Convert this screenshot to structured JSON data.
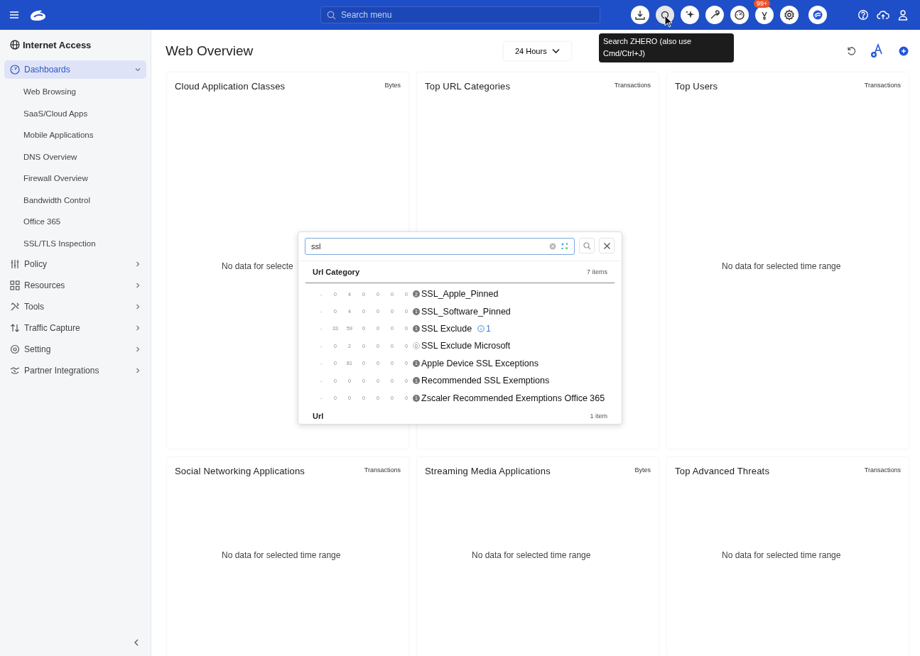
{
  "topbar": {
    "search": {
      "placeholder": "Search menu"
    },
    "notification_badge": "99+",
    "tooltip": "Search ZHERO (also use Cmd/Ctrl+J)"
  },
  "sidebar": {
    "title": "Internet Access",
    "items": [
      {
        "label": "Dashboards",
        "selected": true,
        "expanded": true,
        "children": [
          {
            "label": "Web Browsing"
          },
          {
            "label": "SaaS/Cloud Apps"
          },
          {
            "label": "Mobile Applications"
          },
          {
            "label": "DNS Overview"
          },
          {
            "label": "Firewall Overview"
          },
          {
            "label": "Bandwidth Control"
          },
          {
            "label": "Office 365"
          },
          {
            "label": "SSL/TLS Inspection"
          }
        ]
      },
      {
        "label": "Policy",
        "selected": false,
        "expanded": false
      },
      {
        "label": "Resources",
        "selected": false,
        "expanded": false
      },
      {
        "label": "Tools",
        "selected": false,
        "expanded": false
      },
      {
        "label": "Traffic Capture",
        "selected": false,
        "expanded": false
      },
      {
        "label": "Setting",
        "selected": false,
        "expanded": false
      },
      {
        "label": "Partner Integrations",
        "selected": false,
        "expanded": false
      }
    ]
  },
  "page": {
    "title": "Web Overview",
    "time_range": "24 Hours"
  },
  "cards": [
    {
      "title": "Cloud Application Classes",
      "unit": "Bytes",
      "message": "No data for selecte"
    },
    {
      "title": "Top URL Categories",
      "unit": "Transactions"
    },
    {
      "title": "Top Users",
      "unit": "Transactions",
      "message": "No data for selected time range"
    },
    {
      "title": "Social Networking Applications",
      "unit": "Transactions",
      "message": "No data for selected time range"
    },
    {
      "title": "Streaming Media Applications",
      "unit": "Bytes",
      "message": "No data for selected time range"
    },
    {
      "title": "Top Advanced Threats",
      "unit": "Transactions",
      "message": "No data for selected time range"
    }
  ],
  "search_popup": {
    "value": "ssl",
    "sections": [
      {
        "title": "Url Category",
        "count": "7 items",
        "rows": [
          {
            "cells": [
              "-",
              "0",
              "4",
              "0",
              "0",
              "0",
              "0"
            ],
            "badge": "2",
            "dim": false,
            "name": "SSL_Apple_Pinned"
          },
          {
            "cells": [
              "-",
              "0",
              "4",
              "0",
              "0",
              "0",
              "0"
            ],
            "badge": "1",
            "dim": false,
            "name": "SSL_Software_Pinned"
          },
          {
            "cells": [
              "-",
              "33",
              "59",
              "0",
              "0",
              "0",
              "0"
            ],
            "badge": "1",
            "dim": false,
            "name": "SSL Exclude",
            "extra": "1"
          },
          {
            "cells": [
              "-",
              "0",
              "2",
              "0",
              "0",
              "0",
              "0"
            ],
            "badge": "0",
            "dim": true,
            "name": "SSL Exclude Microsoft"
          },
          {
            "cells": [
              "-",
              "0",
              "81",
              "0",
              "0",
              "0",
              "0"
            ],
            "badge": "1",
            "dim": false,
            "name": "Apple Device SSL Exceptions"
          },
          {
            "cells": [
              "-",
              "0",
              "0",
              "0",
              "0",
              "0",
              "0"
            ],
            "badge": "1",
            "dim": false,
            "name": "Recommended SSL Exemptions"
          },
          {
            "cells": [
              "-",
              "0",
              "0",
              "0",
              "0",
              "0",
              "0"
            ],
            "badge": "1",
            "dim": false,
            "name": "Zscaler Recommended Exemptions Office 365"
          }
        ]
      },
      {
        "title": "Url",
        "count": "1 item"
      }
    ]
  }
}
